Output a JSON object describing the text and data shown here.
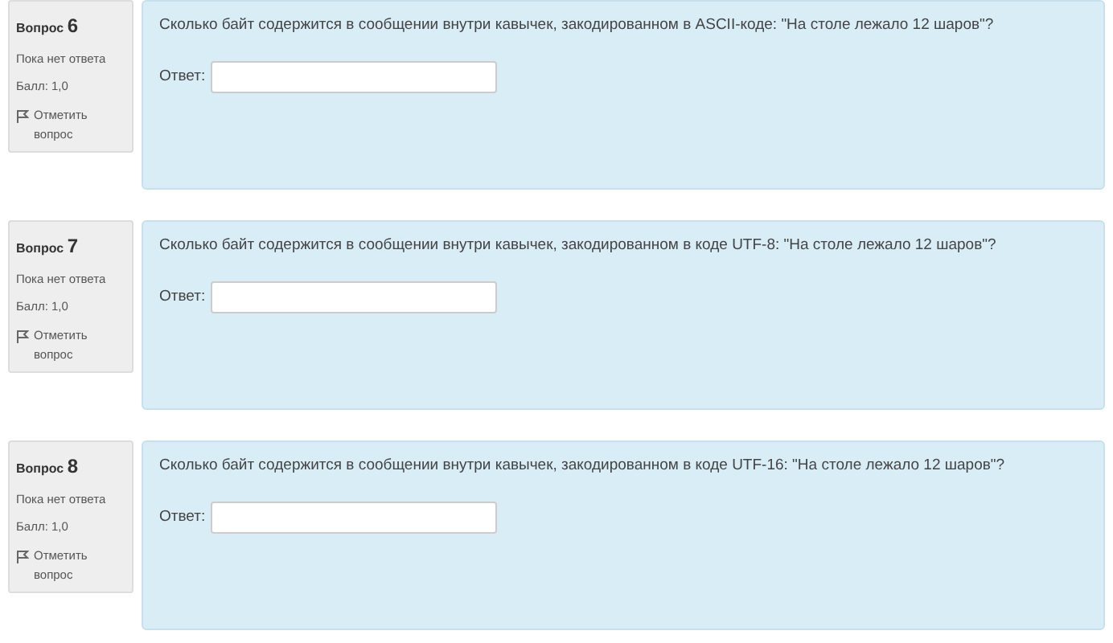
{
  "questions": [
    {
      "label": "Вопрос",
      "number": "6",
      "status": "Пока нет ответа",
      "score": "Балл: 1,0",
      "flag": "Отметить вопрос",
      "text": "Сколько байт содержится в сообщении внутри кавычек, закодированном в ASCII-коде: \"На столе лежало 12 шаров\"?",
      "answer_label": "Ответ:"
    },
    {
      "label": "Вопрос",
      "number": "7",
      "status": "Пока нет ответа",
      "score": "Балл: 1,0",
      "flag": "Отметить вопрос",
      "text": "Сколько байт содержится в сообщении внутри кавычек, закодированном в коде UTF-8: \"На столе лежало 12 шаров\"?",
      "answer_label": "Ответ:"
    },
    {
      "label": "Вопрос",
      "number": "8",
      "status": "Пока нет ответа",
      "score": "Балл: 1,0",
      "flag": "Отметить вопрос",
      "text": "Сколько байт содержится в сообщении внутри кавычек, закодированном в коде UTF-16: \"На столе лежало 12 шаров\"?",
      "answer_label": "Ответ:"
    }
  ]
}
